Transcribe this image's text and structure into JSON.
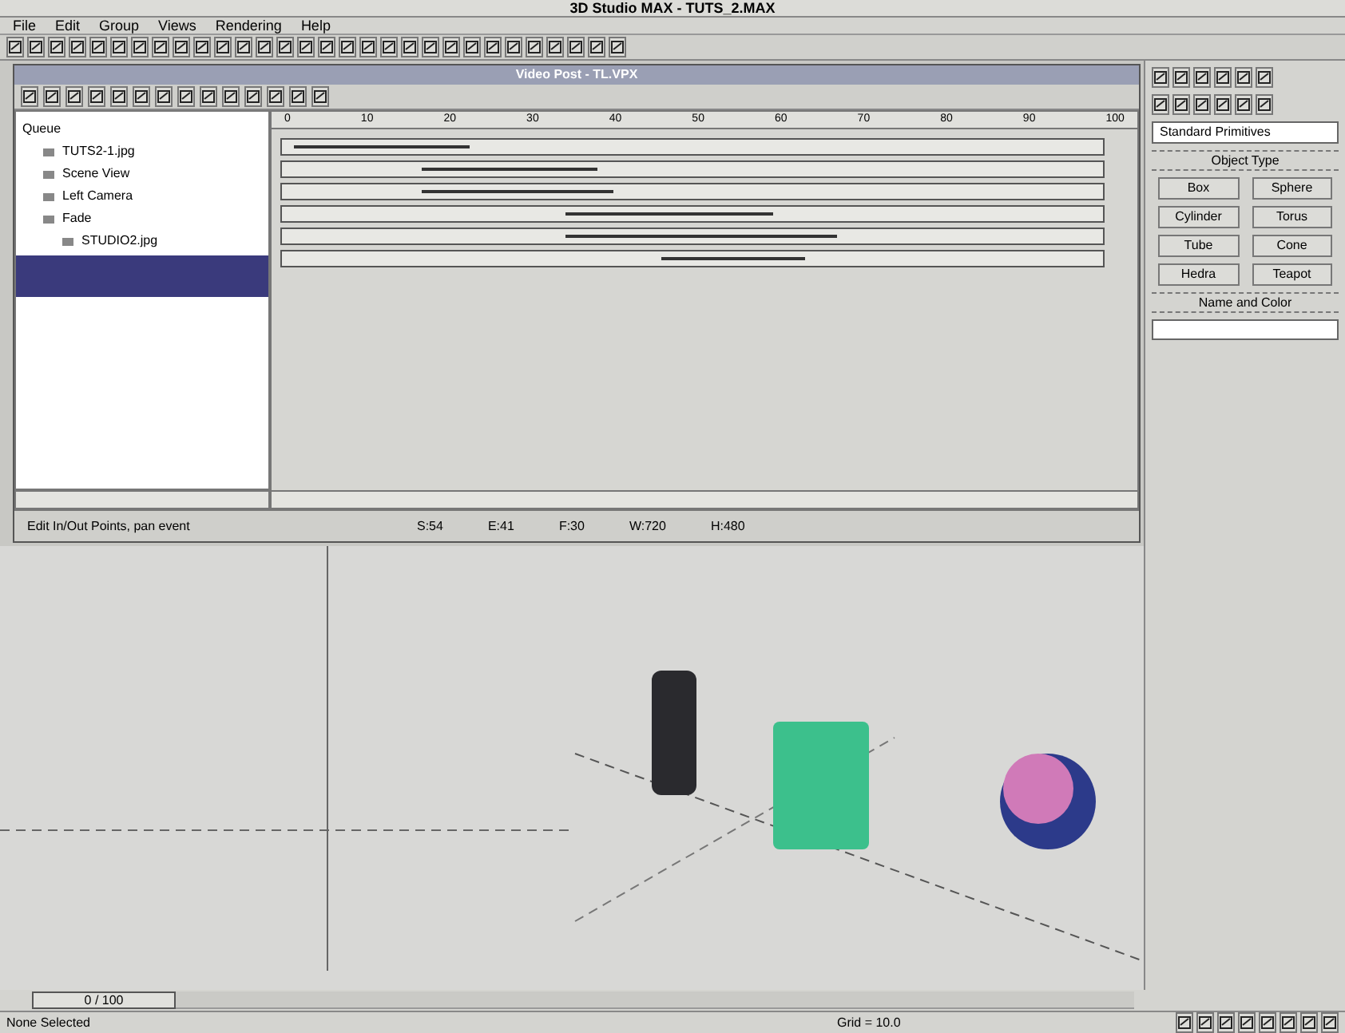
{
  "window": {
    "title": "3D Studio MAX - TUTS_2.MAX"
  },
  "menu": [
    "File",
    "Edit",
    "Group",
    "Views",
    "Rendering",
    "Help"
  ],
  "video_post": {
    "title": "Video Post - TL.VPX",
    "queue": [
      {
        "label": "Queue",
        "children": [
          {
            "label": "TUTS2-1.jpg"
          },
          {
            "label": "Scene View"
          },
          {
            "label": "Left Camera"
          },
          {
            "label": "Fade",
            "children": [
              {
                "label": "STUDIO2.jpg"
              }
            ]
          }
        ]
      }
    ],
    "ruler": [
      "0",
      "10",
      "20",
      "30",
      "40",
      "50",
      "60",
      "70",
      "80",
      "90",
      "100"
    ],
    "status": "Edit In/Out Points, pan event",
    "readouts": [
      "S:54",
      "E:41",
      "F:30",
      "W:720",
      "H:480"
    ]
  },
  "command_panel": {
    "category": "Standard Primitives",
    "object_type": "Object Type",
    "buttons": [
      "Box",
      "Sphere",
      "Cylinder",
      "Torus",
      "Tube",
      "Cone",
      "Hedra",
      "Teapot"
    ],
    "name_rollout": "Name and Color"
  },
  "time_slider": {
    "label": "0 / 100",
    "level": 0
  },
  "status_bar": {
    "selection": "None Selected",
    "grid": "Grid = 10.0"
  }
}
